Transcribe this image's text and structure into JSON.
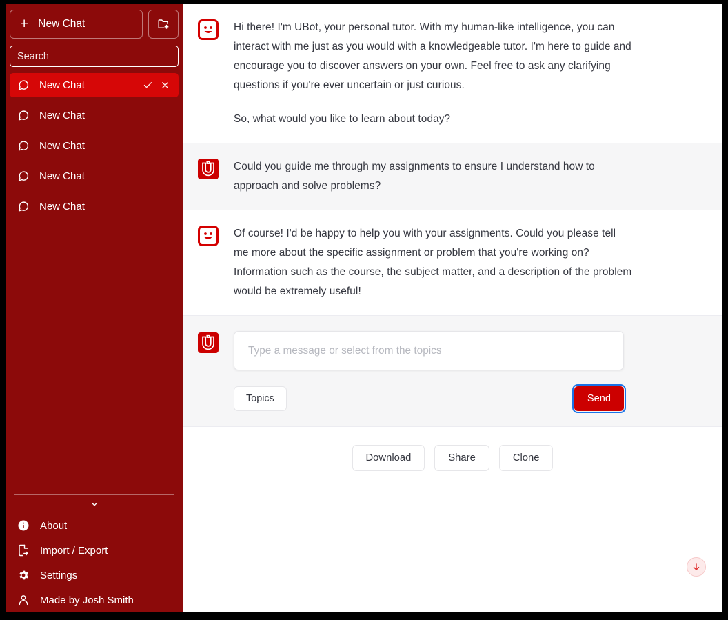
{
  "sidebar": {
    "new_chat_label": "New Chat",
    "new_folder_icon": "new-folder-icon",
    "search": {
      "placeholder": "Search",
      "value": ""
    },
    "chats": [
      {
        "label": "New Chat",
        "selected": true
      },
      {
        "label": "New Chat",
        "selected": false
      },
      {
        "label": "New Chat",
        "selected": false
      },
      {
        "label": "New Chat",
        "selected": false
      },
      {
        "label": "New Chat",
        "selected": false
      }
    ],
    "row_actions": {
      "confirm": "check-icon",
      "cancel": "close-icon"
    },
    "collapse_icon": "chevron-down-icon",
    "footer_items": [
      {
        "label": "About",
        "icon": "info-icon"
      },
      {
        "label": "Import / Export",
        "icon": "import-export-icon"
      },
      {
        "label": "Settings",
        "icon": "gear-icon"
      },
      {
        "label": "Made by Josh Smith",
        "icon": "person-icon"
      }
    ]
  },
  "conversation": {
    "messages": [
      {
        "role": "assistant",
        "avatar": "ubot-smiley-avatar",
        "paragraphs": [
          "Hi there! I'm UBot, your personal tutor. With my human-like intelligence, you can interact with me just as you would with a knowledgeable tutor. I'm here to guide and encourage you to discover answers on your own. Feel free to ask any clarifying questions if you're ever uncertain or just curious.",
          "So, what would you like to learn about today?"
        ]
      },
      {
        "role": "user",
        "avatar": "utah-u-avatar",
        "paragraphs": [
          "Could you guide me through my assignments to ensure I understand how to approach and solve problems?"
        ]
      },
      {
        "role": "assistant",
        "avatar": "ubot-smiley-avatar",
        "paragraphs": [
          "Of course! I'd be happy to help you with your assignments. Could you please tell me more about the specific assignment or problem that you're working on? Information such as the course, the subject matter, and a description of the problem would be extremely useful!"
        ]
      }
    ]
  },
  "composer": {
    "avatar": "utah-u-avatar",
    "input": {
      "placeholder": "Type a message or select from the topics",
      "value": ""
    },
    "topics_label": "Topics",
    "send_label": "Send"
  },
  "footer": {
    "buttons": [
      {
        "label": "Download"
      },
      {
        "label": "Share"
      },
      {
        "label": "Clone"
      }
    ],
    "scroll_down_icon": "arrow-down-icon"
  },
  "colors": {
    "sidebar_bg": "#8c0a0a",
    "selected_chat_bg": "#d60707",
    "brand_red": "#cc0000",
    "assistant_bg": "#ffffff",
    "user_bg": "#f6f6f7",
    "text": "#353740",
    "focus_ring": "#1a73e8"
  }
}
